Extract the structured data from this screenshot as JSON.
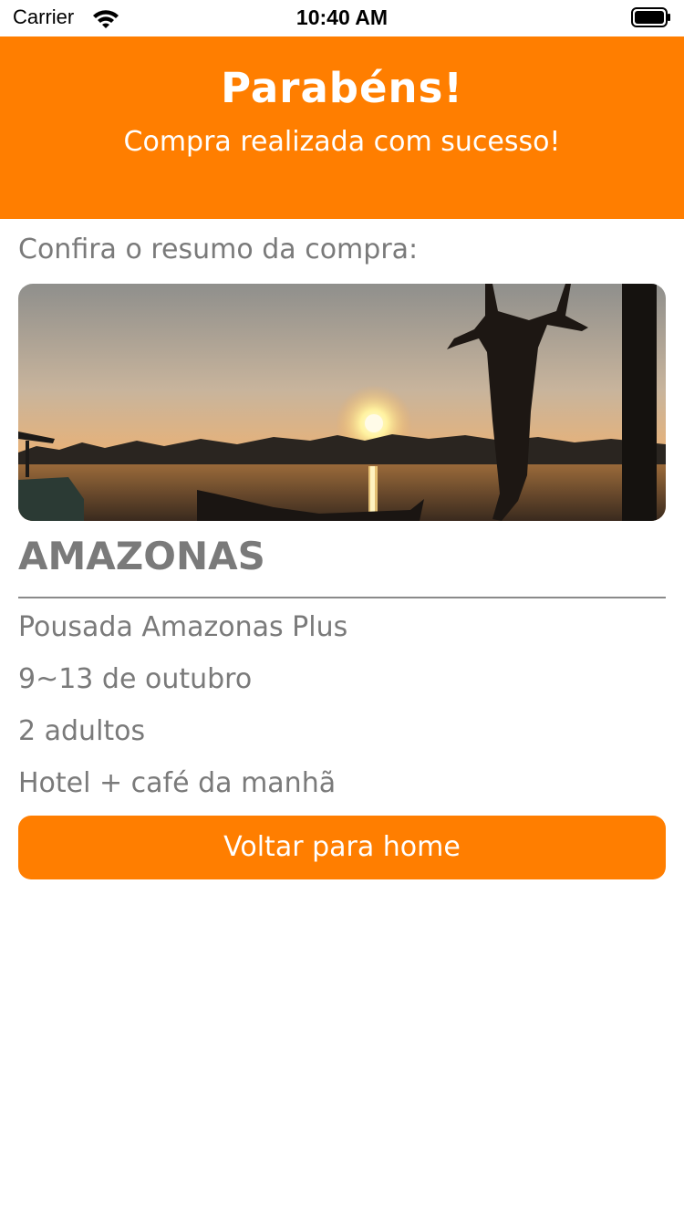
{
  "status_bar": {
    "carrier": "Carrier",
    "time": "10:40 AM",
    "wifi_icon": "wifi-icon",
    "battery_icon": "battery-icon"
  },
  "header": {
    "title": "Parabéns!",
    "subtitle": "Compra realizada com sucesso!"
  },
  "summary": {
    "label": "Confira o resumo da compra:",
    "photo": "sunset-river-photo",
    "destination": "AMAZONAS",
    "hotel": "Pousada Amazonas Plus",
    "dates": "9~13 de outubro",
    "guests": "2 adultos",
    "package": "Hotel + café da manhã"
  },
  "actions": {
    "home_button": "Voltar para home"
  },
  "colors": {
    "accent": "#ff7e00",
    "text_gray": "#7a7a7a",
    "background": "#ffffff"
  }
}
